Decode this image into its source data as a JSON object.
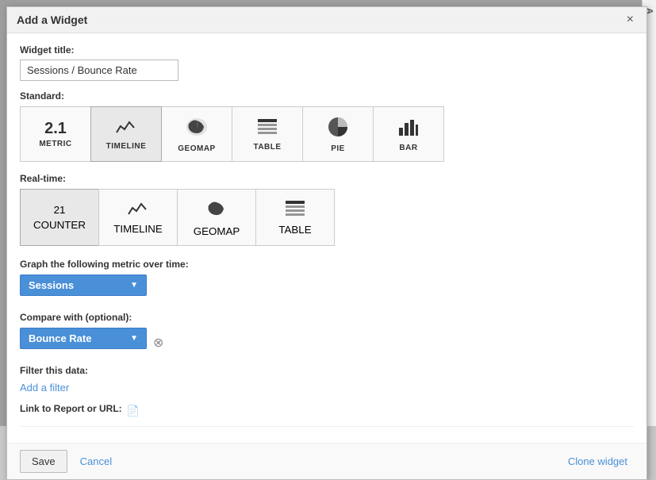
{
  "dialog": {
    "title": "Add a Widget",
    "close_label": "×"
  },
  "widget_title_field": {
    "label": "Widget title:",
    "value": "Sessions / Bounce Rate"
  },
  "standard_section": {
    "label": "Standard:",
    "types": [
      {
        "id": "metric",
        "display": "2.1",
        "label": "METRIC",
        "icon_type": "number"
      },
      {
        "id": "timeline",
        "display": "",
        "label": "TIMELINE",
        "icon_type": "timeline",
        "active": true
      },
      {
        "id": "geomap",
        "display": "",
        "label": "GEOMAP",
        "icon_type": "map"
      },
      {
        "id": "table",
        "display": "",
        "label": "TABLE",
        "icon_type": "table"
      },
      {
        "id": "pie",
        "display": "",
        "label": "PIE",
        "icon_type": "pie"
      },
      {
        "id": "bar",
        "display": "",
        "label": "BAR",
        "icon_type": "bar"
      }
    ]
  },
  "realtime_section": {
    "label": "Real-time:",
    "types": [
      {
        "id": "counter",
        "display": "21",
        "label": "COUNTER",
        "icon_type": "number",
        "active": true
      },
      {
        "id": "timeline",
        "display": "",
        "label": "TIMELINE",
        "icon_type": "timeline"
      },
      {
        "id": "geomap",
        "display": "",
        "label": "GEOMAP",
        "icon_type": "map"
      },
      {
        "id": "table",
        "display": "",
        "label": "TABLE",
        "icon_type": "table"
      }
    ]
  },
  "graph_metric": {
    "label": "Graph the following metric over time:",
    "value": "Sessions"
  },
  "compare_with": {
    "label": "Compare with (optional):",
    "value": "Bounce Rate"
  },
  "filter_section": {
    "label": "Filter this data:",
    "add_filter_text": "Add a filter"
  },
  "link_section": {
    "label": "Link to Report or URL:",
    "value": ""
  },
  "footer": {
    "save_label": "Save",
    "cancel_label": "Cancel",
    "clone_label": "Clone widget"
  },
  "side_panel": {
    "letter": "A"
  }
}
